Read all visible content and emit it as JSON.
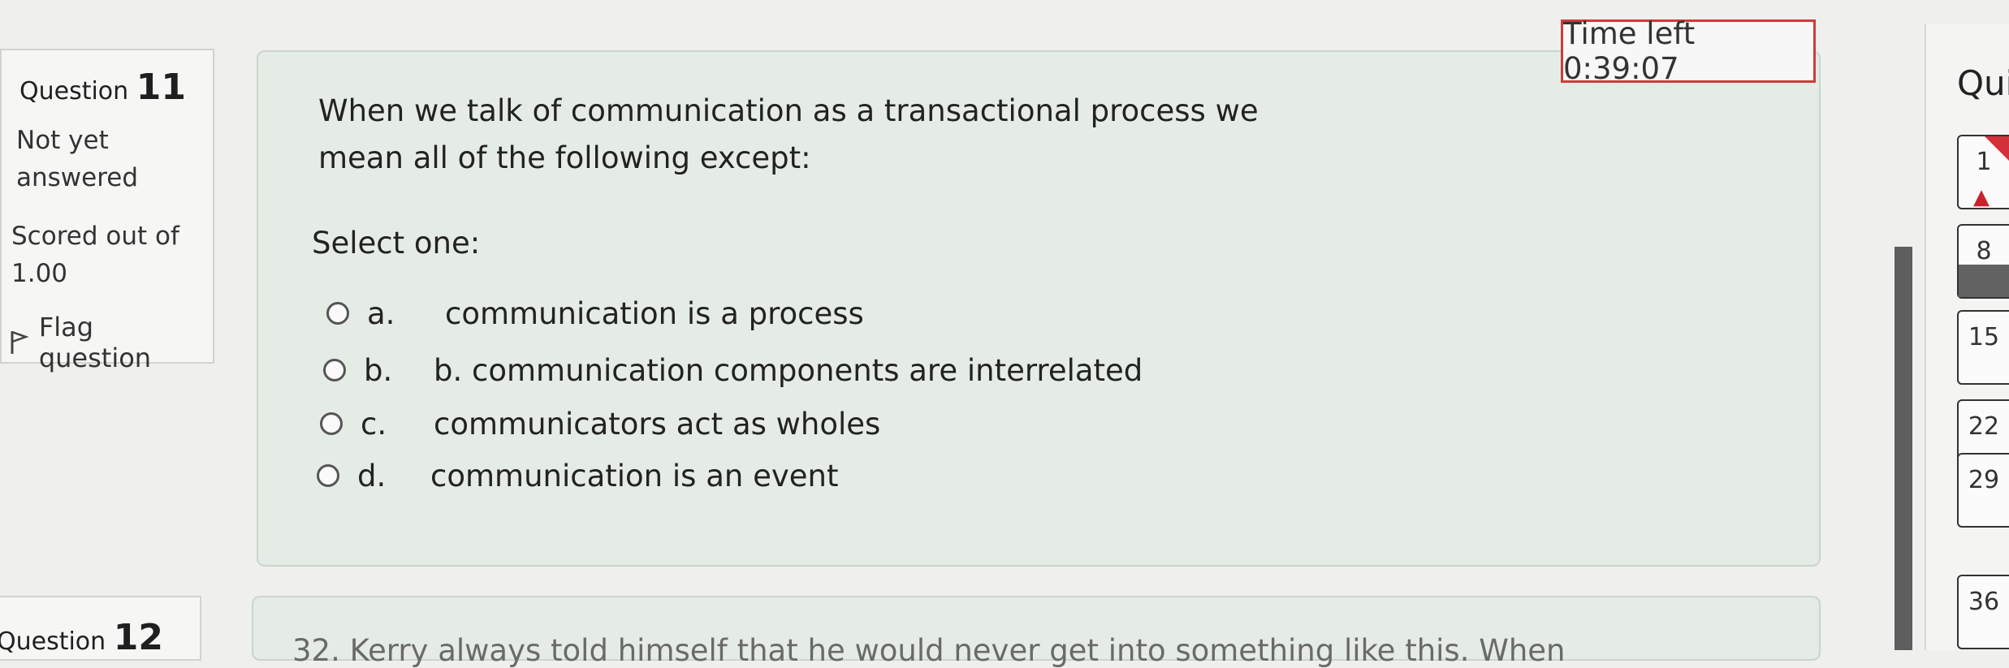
{
  "timer": {
    "label": "Time left 0:39:07"
  },
  "question11": {
    "label": "Question",
    "number": "11",
    "status_line1": "Not yet",
    "status_line2": "answered",
    "score_line1": "Scored out of",
    "score_line2": "1.00",
    "flag_label": "Flag question",
    "text_line1": "When we talk of communication as a transactional process we",
    "text_line2": "mean all of the following except:",
    "select_prompt": "Select one:",
    "answers": [
      {
        "letter": "a.",
        "text": "communication is a process"
      },
      {
        "letter": "b.",
        "text": "b. communication components are interrelated"
      },
      {
        "letter": "c.",
        "text": "communicators act as wholes"
      },
      {
        "letter": "d.",
        "text": "communication is an event"
      }
    ]
  },
  "question12": {
    "label": "Question",
    "number": "12",
    "text_partial": "32. Kerry always told himself that he would never get into something like this. When"
  },
  "quiz_nav": {
    "title": "Qui",
    "buttons": [
      "1",
      "8",
      "15",
      "22",
      "29",
      "36"
    ]
  },
  "colors": {
    "timer_border": "#cf3b3b",
    "content_bg": "#e5ece5",
    "flag_marker": "#d3303a"
  }
}
